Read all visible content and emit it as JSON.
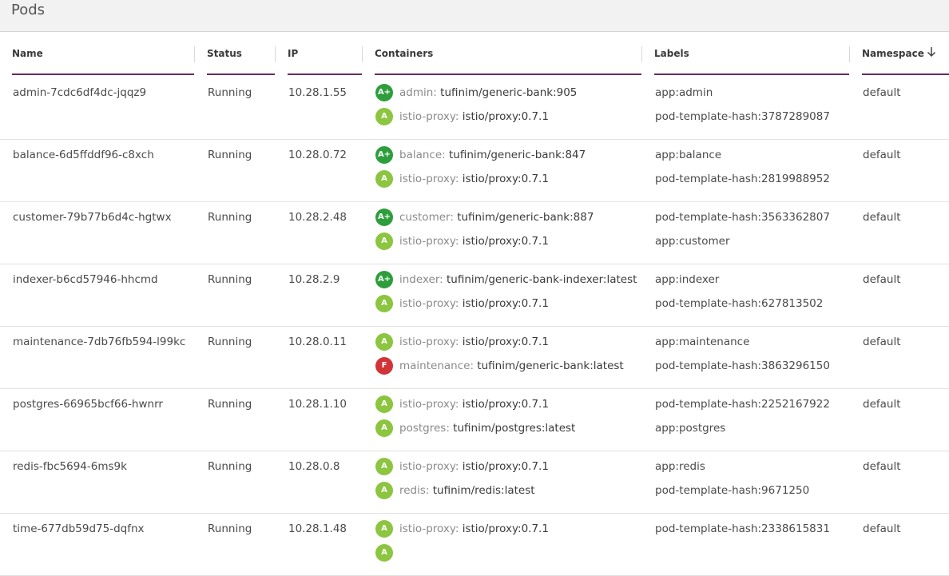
{
  "page": {
    "title": "Pods"
  },
  "colors": {
    "grade_a_plus": "#2e9e3c",
    "grade_a": "#8cc540",
    "grade_f": "#d13438",
    "header_underline": "#6b2a5f"
  },
  "columns": {
    "name": "Name",
    "status": "Status",
    "ip": "IP",
    "containers": "Containers",
    "labels": "Labels",
    "namespace": "Namespace",
    "namespace_sort": "arrow-down-icon"
  },
  "rows": [
    {
      "name": "admin-7cdc6df4dc-jqqz9",
      "status": "Running",
      "ip": "10.28.1.55",
      "containers": [
        {
          "grade": "A+",
          "name": "admin:",
          "image": "tufinim/generic-bank:905"
        },
        {
          "grade": "A",
          "name": "istio-proxy:",
          "image": "istio/proxy:0.7.1"
        }
      ],
      "labels": [
        "app:admin",
        "pod-template-hash:3787289087"
      ],
      "namespace": "default"
    },
    {
      "name": "balance-6d5ffddf96-c8xch",
      "status": "Running",
      "ip": "10.28.0.72",
      "containers": [
        {
          "grade": "A+",
          "name": "balance:",
          "image": "tufinim/generic-bank:847"
        },
        {
          "grade": "A",
          "name": "istio-proxy:",
          "image": "istio/proxy:0.7.1"
        }
      ],
      "labels": [
        "app:balance",
        "pod-template-hash:2819988952"
      ],
      "namespace": "default"
    },
    {
      "name": "customer-79b77b6d4c-hgtwx",
      "status": "Running",
      "ip": "10.28.2.48",
      "containers": [
        {
          "grade": "A+",
          "name": "customer:",
          "image": "tufinim/generic-bank:887"
        },
        {
          "grade": "A",
          "name": "istio-proxy:",
          "image": "istio/proxy:0.7.1"
        }
      ],
      "labels": [
        "pod-template-hash:3563362807",
        "app:customer"
      ],
      "namespace": "default"
    },
    {
      "name": "indexer-b6cd57946-hhcmd",
      "status": "Running",
      "ip": "10.28.2.9",
      "containers": [
        {
          "grade": "A+",
          "name": "indexer:",
          "image": "tufinim/generic-bank-indexer:latest"
        },
        {
          "grade": "A",
          "name": "istio-proxy:",
          "image": "istio/proxy:0.7.1"
        }
      ],
      "labels": [
        "app:indexer",
        "pod-template-hash:627813502"
      ],
      "namespace": "default"
    },
    {
      "name": "maintenance-7db76fb594-l99kc",
      "status": "Running",
      "ip": "10.28.0.11",
      "containers": [
        {
          "grade": "A",
          "name": "istio-proxy:",
          "image": "istio/proxy:0.7.1"
        },
        {
          "grade": "F",
          "name": "maintenance:",
          "image": "tufinim/generic-bank:latest"
        }
      ],
      "labels": [
        "app:maintenance",
        "pod-template-hash:3863296150"
      ],
      "namespace": "default"
    },
    {
      "name": "postgres-66965bcf66-hwnrr",
      "status": "Running",
      "ip": "10.28.1.10",
      "containers": [
        {
          "grade": "A",
          "name": "istio-proxy:",
          "image": "istio/proxy:0.7.1"
        },
        {
          "grade": "A",
          "name": "postgres:",
          "image": "tufinim/postgres:latest"
        }
      ],
      "labels": [
        "pod-template-hash:2252167922",
        "app:postgres"
      ],
      "namespace": "default"
    },
    {
      "name": "redis-fbc5694-6ms9k",
      "status": "Running",
      "ip": "10.28.0.8",
      "containers": [
        {
          "grade": "A",
          "name": "istio-proxy:",
          "image": "istio/proxy:0.7.1"
        },
        {
          "grade": "A",
          "name": "redis:",
          "image": "tufinim/redis:latest"
        }
      ],
      "labels": [
        "app:redis",
        "pod-template-hash:9671250"
      ],
      "namespace": "default"
    },
    {
      "name": "time-677db59d75-dqfnx",
      "status": "Running",
      "ip": "10.28.1.48",
      "containers": [
        {
          "grade": "A",
          "name": "istio-proxy:",
          "image": "istio/proxy:0.7.1"
        },
        {
          "grade": "A",
          "name": "",
          "image": ""
        }
      ],
      "labels": [
        "pod-template-hash:2338615831",
        ""
      ],
      "namespace": "default"
    }
  ]
}
